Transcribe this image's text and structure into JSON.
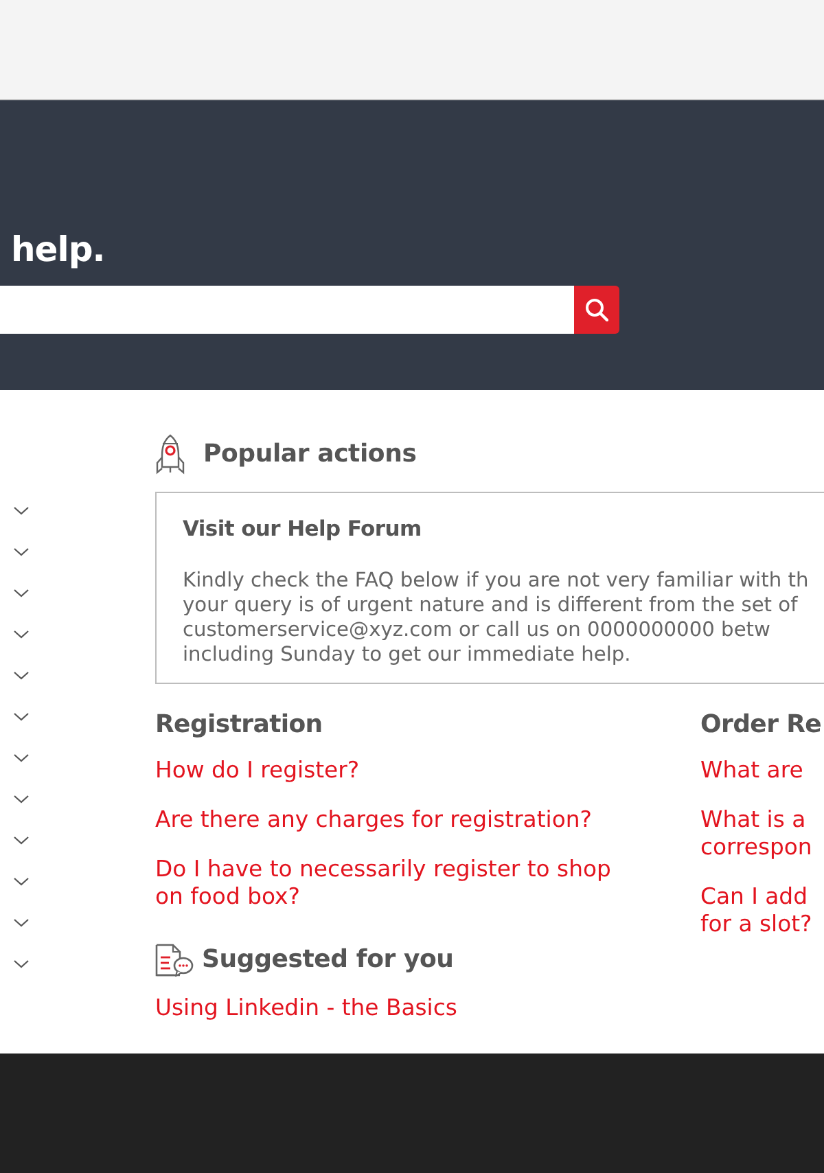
{
  "header": {
    "title": "help."
  },
  "sidebar": {
    "items": [
      {
        "expanded": false
      },
      {
        "expanded": false
      },
      {
        "expanded": false
      },
      {
        "expanded": false
      },
      {
        "expanded": false
      },
      {
        "expanded": false
      },
      {
        "expanded": false
      },
      {
        "expanded": false
      },
      {
        "expanded": false
      },
      {
        "expanded": false
      },
      {
        "expanded": false
      },
      {
        "expanded": false
      }
    ]
  },
  "popular_actions": {
    "title": "Popular actions",
    "card": {
      "title": "Visit our Help Forum",
      "text": "Kindly check the FAQ below if you are not very familiar with th\nyour query is of urgent nature and is different from the set of\ncustomerservice@xyz.com or call us on 0000000000 betw\nincluding Sunday to get our immediate help."
    }
  },
  "faq_sections": [
    {
      "title": "Registration",
      "links": [
        "How do I register?",
        "Are there any charges for registration?",
        "Do I have to necessarily register to shop on food box?"
      ]
    },
    {
      "title": "Order Re",
      "links": [
        "What are",
        "What is a\ncorrespon",
        "Can I add\nfor a slot?"
      ]
    }
  ],
  "suggested": {
    "title": "Suggested for you",
    "links": [
      "Using Linkedin - the Basics"
    ]
  }
}
